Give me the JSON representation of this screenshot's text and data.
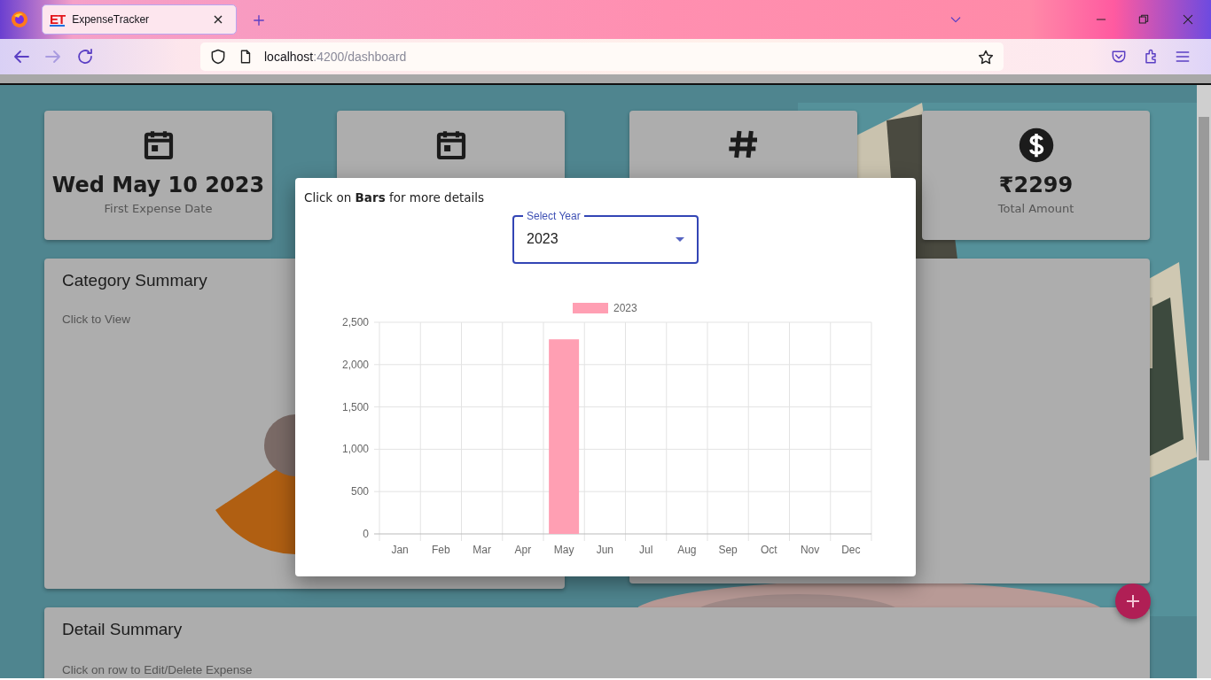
{
  "browser": {
    "tab": {
      "favicon_text": "ET",
      "title": "ExpenseTracker"
    },
    "url": {
      "host": "localhost",
      "path": ":4200/dashboard"
    }
  },
  "stat_cards": [
    {
      "kind": "calendar",
      "value": "Wed May 10 2023",
      "label": "First Expense Date"
    },
    {
      "kind": "calendar"
    },
    {
      "kind": "hash"
    },
    {
      "kind": "dollar",
      "value": "₹2299",
      "label": "Total Amount"
    }
  ],
  "category_summary": {
    "title": "Category Summary",
    "hint": "Click to View"
  },
  "detail_summary": {
    "title": "Detail Summary",
    "hint": "Click on row to Edit/Delete Expense"
  },
  "dialog": {
    "instruction": "Click on **Bars** for more details",
    "select": {
      "label": "Select Year",
      "value": "2023"
    },
    "chart_data": {
      "type": "bar",
      "categories": [
        "Jan",
        "Feb",
        "Mar",
        "Apr",
        "May",
        "Jun",
        "Jul",
        "Aug",
        "Sep",
        "Oct",
        "Nov",
        "Dec"
      ],
      "series": [
        {
          "name": "2023",
          "color": "#ff9fb3",
          "values": [
            0,
            0,
            0,
            0,
            2299,
            0,
            0,
            0,
            0,
            0,
            0,
            0
          ]
        }
      ],
      "ylim": [
        0,
        2500
      ],
      "grid": true,
      "yticks": [
        {
          "value": 0,
          "label": "0"
        },
        {
          "value": 500,
          "label": "500"
        },
        {
          "value": 1000,
          "label": "1,000"
        },
        {
          "value": 1500,
          "label": "1,500"
        },
        {
          "value": 2000,
          "label": "2,000"
        },
        {
          "value": 2500,
          "label": "2,500"
        }
      ]
    }
  }
}
